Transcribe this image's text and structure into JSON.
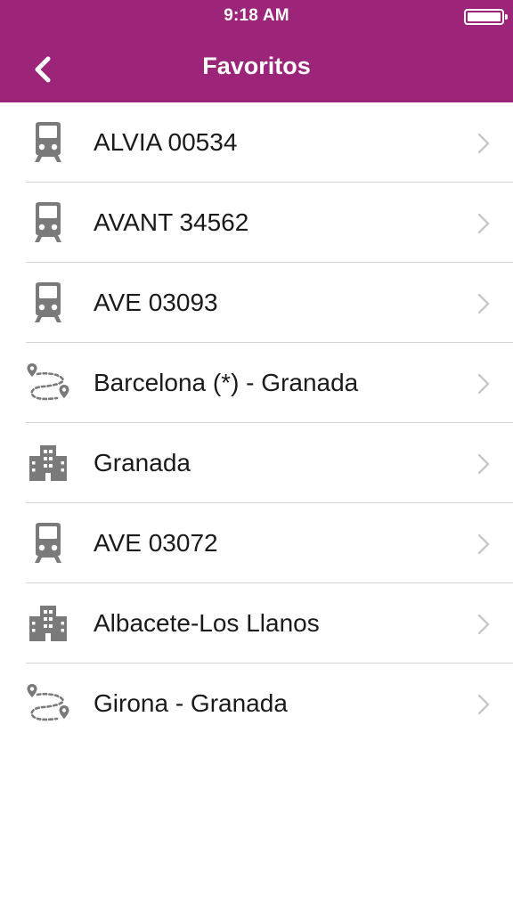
{
  "status": {
    "time": "9:18 AM"
  },
  "navbar": {
    "title": "Favoritos",
    "back_icon": "chevron-left-icon"
  },
  "colors": {
    "brand": "#9c2479",
    "icon_gray": "#7a7a7a",
    "chevron_gray": "#c7c7cc",
    "separator": "#d5d5d5"
  },
  "favorites": [
    {
      "icon": "train-icon",
      "label": "ALVIA 00534"
    },
    {
      "icon": "train-icon",
      "label": "AVANT 34562"
    },
    {
      "icon": "train-icon",
      "label": "AVE 03093"
    },
    {
      "icon": "route-icon",
      "label": "Barcelona (*) - Granada"
    },
    {
      "icon": "station-icon",
      "label": "Granada"
    },
    {
      "icon": "train-icon",
      "label": "AVE 03072"
    },
    {
      "icon": "station-icon",
      "label": "Albacete-Los Llanos"
    },
    {
      "icon": "route-icon",
      "label": "Girona - Granada"
    }
  ]
}
